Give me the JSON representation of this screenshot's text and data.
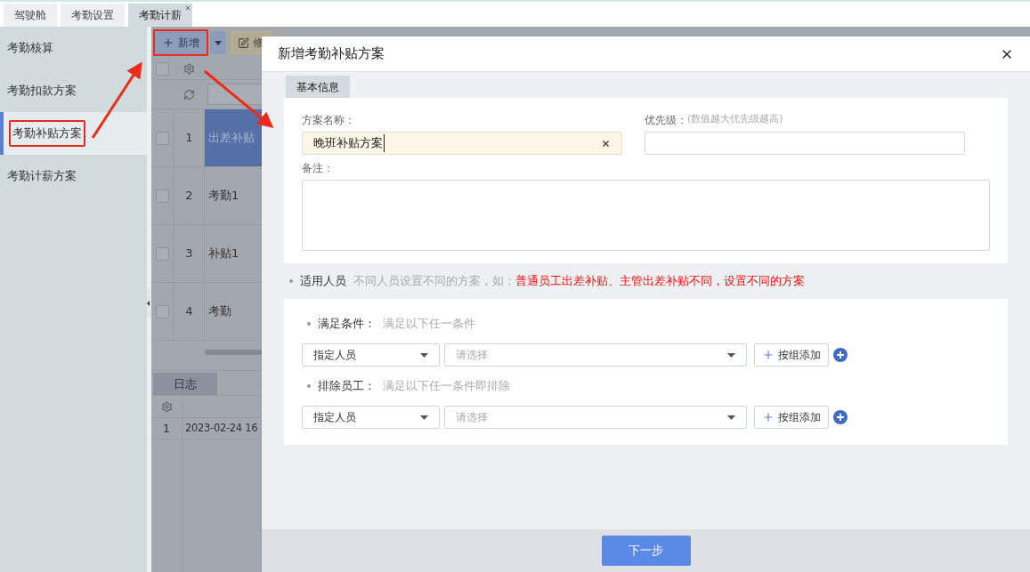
{
  "top_tabs": [
    {
      "label": "驾驶舱",
      "selected": false
    },
    {
      "label": "考勤设置",
      "selected": false
    },
    {
      "label": "考勤计薪",
      "selected": true
    }
  ],
  "sidebar": {
    "items": [
      {
        "label": "考勤核算",
        "selected": false,
        "highlighted": false
      },
      {
        "label": "考勤扣款方案",
        "selected": false,
        "highlighted": false
      },
      {
        "label": "考勤补贴方案",
        "selected": true,
        "highlighted": true
      },
      {
        "label": "考勤计薪方案",
        "selected": false,
        "highlighted": false
      }
    ]
  },
  "toolbar": {
    "add_button": {
      "label": "新增",
      "highlighted": true
    },
    "edit_button": {
      "label": "修"
    }
  },
  "table": {
    "header_checked": false,
    "rows": [
      {
        "index": "1",
        "name": "出差补贴",
        "selected": true,
        "checked": false
      },
      {
        "index": "2",
        "name": "考勤1",
        "selected": false,
        "checked": false
      },
      {
        "index": "3",
        "name": "补贴1",
        "selected": false,
        "checked": false
      },
      {
        "index": "4",
        "name": "考勤",
        "selected": false,
        "checked": false
      }
    ]
  },
  "log": {
    "tab": "日志",
    "rows": [
      {
        "index": "1",
        "time": "2023-02-24 16"
      }
    ]
  },
  "dialog": {
    "title": "新增考勤补贴方案",
    "tabs": [
      {
        "label": "基本信息",
        "selected": true
      }
    ],
    "name_field": {
      "label": "方案名称：",
      "value": "晚班补贴方案"
    },
    "priority_field": {
      "label": "优先级：",
      "hint": "(数值越大优先级越高)"
    },
    "remark_field": {
      "label": "备注："
    },
    "applicable": {
      "label": "适用人员",
      "hint": "不同人员设置不同的方案，如：",
      "highlight": "普通员工出差补贴、主管出差补贴不同，设置不同的方案"
    },
    "conditions": [
      {
        "label": "满足条件：",
        "hint": "满足以下任一条件",
        "type_value": "指定人员",
        "placeholder": "请选择",
        "add_button": "按组添加"
      },
      {
        "label": "排除员工：",
        "hint": "满足以下任一条件即排除",
        "type_value": "指定人员",
        "placeholder": "请选择",
        "add_button": "按组添加"
      }
    ],
    "next_button": "下一步"
  }
}
